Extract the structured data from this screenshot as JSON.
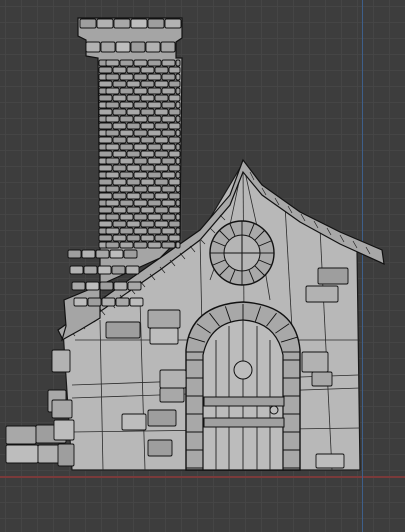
{
  "viewport": {
    "mode": "wireframe-overlay",
    "grid": true,
    "axes": [
      "x",
      "y"
    ]
  },
  "colors": {
    "background": "#3d3d3d",
    "grid": "#464646",
    "axis_x": "#7a3a3a",
    "axis_y": "#3e5f8a",
    "mesh_fill": "#b5b5b5",
    "mesh_fill_light": "#c2c2c2",
    "mesh_fill_dark": "#9a9a9a",
    "wire": "#1a1a1a"
  },
  "scene": {
    "objects": [
      "chimney",
      "roof",
      "house-wall",
      "round-window",
      "arched-door",
      "door-hinges",
      "door-knob",
      "wall-stones",
      "stone-pile"
    ]
  }
}
